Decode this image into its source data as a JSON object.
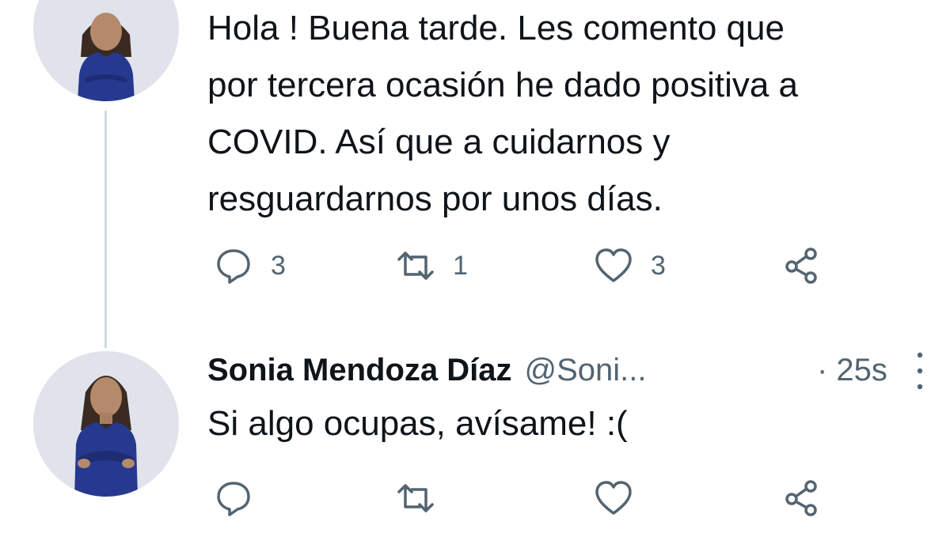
{
  "first_tweet": {
    "text_lines": [
      "Hola ! Buena tarde. Les comento que",
      "por tercera ocasión he dado positiva a",
      "COVID. Así que a cuidarnos y",
      "resguardarnos por unos días."
    ],
    "actions": {
      "reply_count": "3",
      "retweet_count": "1",
      "like_count": "3"
    }
  },
  "reply_tweet": {
    "display_name": "Sonia Mendoza Díaz",
    "handle": "@Soni...",
    "time": "· 25s",
    "text": "Si algo ocupas, avísame! :("
  },
  "icons": {
    "reply": "reply-icon",
    "retweet": "retweet-icon",
    "like": "heart-icon",
    "share": "share-icon",
    "more": "more-vertical-icon"
  },
  "colors": {
    "text": "#0f1419",
    "secondary": "#536471",
    "thread_line": "#cfd9de",
    "avatar_bg": "#e1e3ec",
    "dress": "#26398f"
  }
}
